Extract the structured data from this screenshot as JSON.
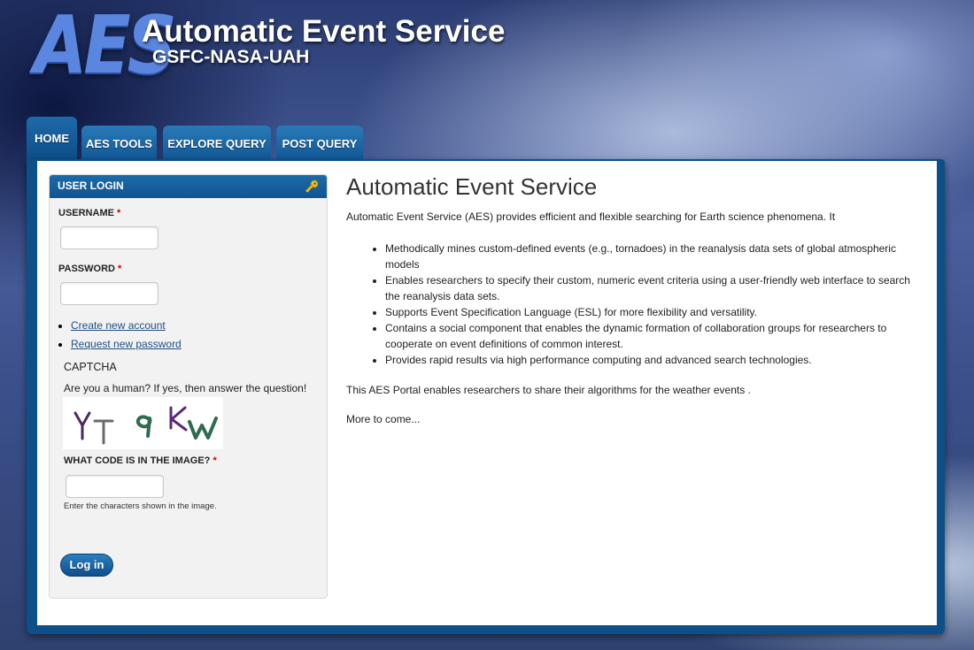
{
  "header": {
    "logo_text": "AES",
    "title": "Automatic Event Service",
    "subtitle": "GSFC-NASA-UAH"
  },
  "tabs": [
    {
      "label": "HOME",
      "active": true
    },
    {
      "label": "AES TOOLS",
      "active": false
    },
    {
      "label": "EXPLORE QUERY",
      "active": false
    },
    {
      "label": "POST QUERY",
      "active": false
    }
  ],
  "login": {
    "header": "USER LOGIN",
    "username_label": "USERNAME",
    "password_label": "PASSWORD",
    "required_mark": "*",
    "links": [
      "Create new account",
      "Request new password"
    ],
    "captcha_title": "CAPTCHA",
    "captcha_question": "Are you a human? If yes, then answer the question!",
    "captcha_image_text": "YT9KW",
    "code_label": "WHAT CODE IS IN THE IMAGE?",
    "code_description": "Enter the characters shown in the image.",
    "submit_label": "Log in"
  },
  "main": {
    "title": "Automatic Event Service",
    "intro": "Automatic Event Service (AES) provides efficient and flexible searching for Earth science phenomena. It",
    "features": [
      "Methodically mines custom-defined events (e.g., tornadoes) in the reanalysis data sets of global atmospheric models",
      "Enables researchers to specify their custom, numeric event criteria using a user-friendly web interface to search the reanalysis data sets.",
      "Supports Event Specification Language (ESL) for more flexibility and versatility.",
      "Contains a social component that enables the dynamic formation of collaboration groups for researchers to cooperate on event definitions of common interest.",
      "Provides rapid results via high performance computing and advanced search technologies."
    ],
    "portal_text": "This AES Portal enables researchers to share their algorithms for the weather events .",
    "more_text": "More to come..."
  },
  "colors": {
    "tab_blue": "#0f5592",
    "link": "#1f4f83",
    "required": "#cc0000"
  }
}
